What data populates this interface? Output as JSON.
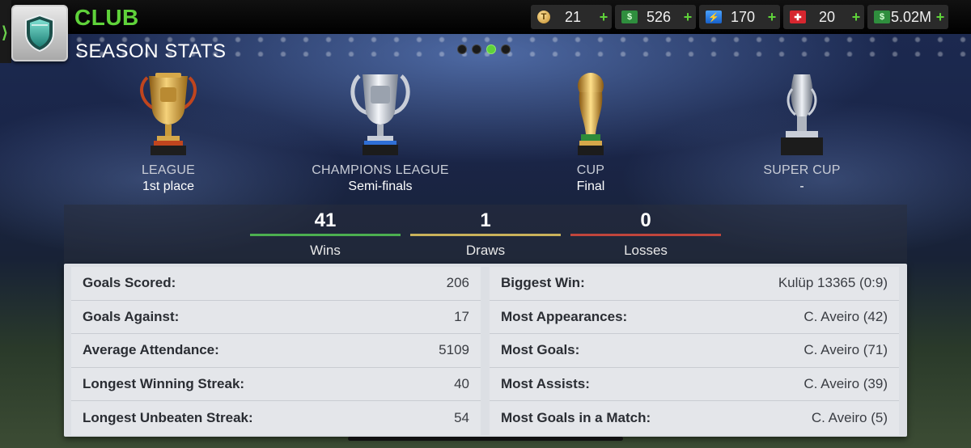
{
  "header": {
    "title": "CLUB",
    "subtitle": "SEASON STATS"
  },
  "currencies": [
    {
      "icon": "token-coin-icon",
      "value": "21",
      "plus": "+"
    },
    {
      "icon": "cash-icon",
      "value": "526",
      "plus": "+"
    },
    {
      "icon": "energy-icon",
      "value": "170",
      "plus": "+"
    },
    {
      "icon": "medical-kit-icon",
      "value": "20",
      "plus": "+"
    },
    {
      "icon": "money-icon",
      "value": "5.02M",
      "plus": "+"
    }
  ],
  "pager": {
    "count": 4,
    "active_index": 2
  },
  "trophies": [
    {
      "name": "LEAGUE",
      "result": "1st place",
      "icon": "league-trophy-icon"
    },
    {
      "name": "CHAMPIONS LEAGUE",
      "result": "Semi-finals",
      "icon": "champions-league-trophy-icon"
    },
    {
      "name": "CUP",
      "result": "Final",
      "icon": "cup-trophy-icon"
    },
    {
      "name": "SUPER CUP",
      "result": "-",
      "icon": "super-cup-trophy-icon"
    }
  ],
  "record": {
    "wins": {
      "value": "41",
      "label": "Wins",
      "color": "#4caf50"
    },
    "draws": {
      "value": "1",
      "label": "Draws",
      "color": "#c9b25a"
    },
    "losses": {
      "value": "0",
      "label": "Losses",
      "color": "#c0453c"
    }
  },
  "stats_left": [
    {
      "label": "Goals Scored:",
      "value": "206"
    },
    {
      "label": "Goals Against:",
      "value": "17"
    },
    {
      "label": "Average Attendance:",
      "value": "5109"
    },
    {
      "label": "Longest Winning Streak:",
      "value": "40"
    },
    {
      "label": "Longest Unbeaten Streak:",
      "value": "54"
    }
  ],
  "stats_right": [
    {
      "label": "Biggest Win:",
      "value": "Kulüp 13365 (0:9)"
    },
    {
      "label": "Most Appearances:",
      "value": "C. Aveiro (42)"
    },
    {
      "label": "Most Goals:",
      "value": "C. Aveiro (71)"
    },
    {
      "label": "Most Assists:",
      "value": "C. Aveiro (39)"
    },
    {
      "label": "Most Goals in a Match:",
      "value": "C. Aveiro (5)"
    }
  ],
  "colors": {
    "accent_green": "#5fd23a",
    "panel_bg": "#dcdfe4"
  }
}
